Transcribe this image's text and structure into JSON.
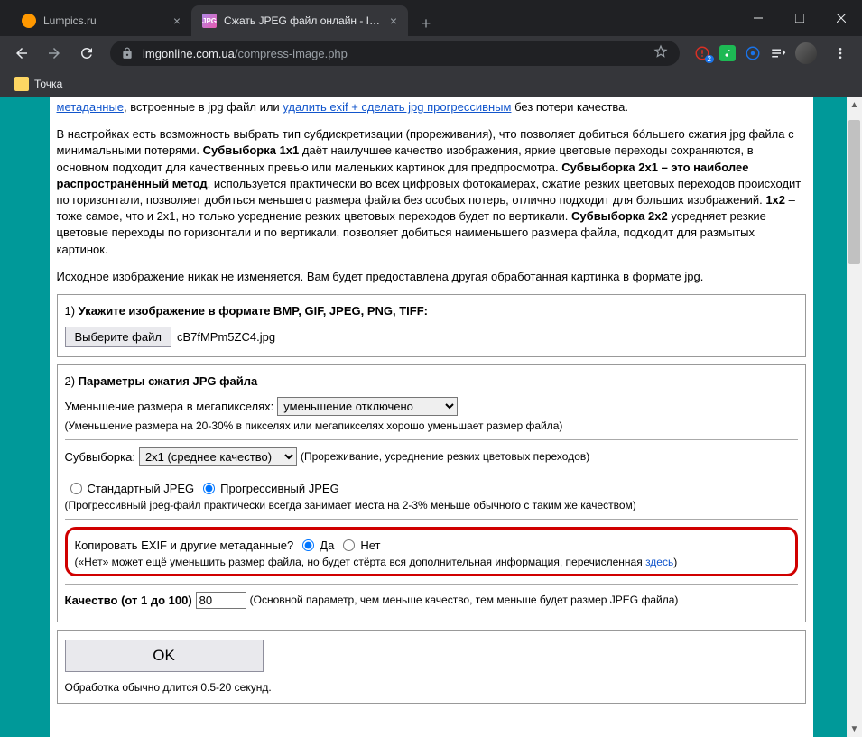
{
  "tabs": [
    {
      "title": "Lumpics.ru"
    },
    {
      "title": "Сжать JPEG файл онлайн - IMG"
    }
  ],
  "url": {
    "domain": "imgonline.com.ua",
    "path": "/compress-image.php"
  },
  "bookmarks": {
    "folder": "Точка"
  },
  "content": {
    "p1_link1": "метаданные",
    "p1_mid": ", встроенные в jpg файл или ",
    "p1_link2": "удалить exif + сделать jpg прогрессивным",
    "p1_end": " без потери качества.",
    "p2_a": "В настройках есть возможность выбрать тип субдискретизации (прореживания), что позволяет добиться бóльшего сжатия jpg файла с минимальными потерями. ",
    "p2_b1": "Субвыборка 1x1",
    "p2_c": " даёт наилучшее качество изображения, яркие цветовые переходы сохраняются, в основном подходит для качественных превью или маленьких картинок для предпросмотра. ",
    "p2_b2": "Субвыборка 2x1 – это наиболее распространённый метод",
    "p2_d": ", используется практически во всех цифровых фотокамерах, сжатие резких цветовых переходов происходит по горизонтали, позволяет добиться меньшего размера файла без особых потерь, отлично подходит для больших изображений. ",
    "p2_b3": "1x2",
    "p2_e": " – тоже самое, что и 2x1, но только усреднение резких цветовых переходов будет по вертикали. ",
    "p2_b4": "Субвыборка 2x2",
    "p2_f": " усредняет резкие цветовые переходы по горизонтали и по вертикали, позволяет добиться наименьшего размера файла, подходит для размытых картинок.",
    "p3": "Исходное изображение никак не изменяется. Вам будет предоставлена другая обработанная картинка в формате jpg."
  },
  "step1": {
    "title_num": "1) ",
    "title": "Укажите изображение в формате BMP, GIF, JPEG, PNG, TIFF:",
    "file_btn": "Выберите файл",
    "filename": "cB7fMPm5ZC4.jpg"
  },
  "step2": {
    "title_num": "2) ",
    "title": "Параметры сжатия JPG файла",
    "resize_label": "Уменьшение размера в мегапикселях:",
    "resize_value": "уменьшение отключено",
    "resize_hint": "(Уменьшение размера на 20-30% в пикселях или мегапикселях хорошо уменьшает размер файла)",
    "subsample_label": "Субвыборка:",
    "subsample_value": "2x1 (среднее качество)",
    "subsample_hint": "(Прореживание, усреднение резких цветовых переходов)",
    "jpeg_std": "Стандартный JPEG",
    "jpeg_prog": "Прогрессивный JPEG",
    "jpeg_hint": "(Прогрессивный jpeg-файл практически всегда занимает места на 2-3% меньше обычного с таким же качеством)",
    "exif_label": "Копировать EXIF и другие метаданные?",
    "exif_yes": "Да",
    "exif_no": "Нет",
    "exif_hint_a": "(«Нет» может ещё уменьшить размер файла, но будет стёрта вся дополнительная информация, перечисленная ",
    "exif_hint_link": "здесь",
    "exif_hint_b": ")",
    "quality_label": "Качество (от 1 до 100)",
    "quality_value": "80",
    "quality_hint": "(Основной параметр, чем меньше качество, тем меньше будет размер JPEG файла)"
  },
  "step3": {
    "ok_btn": "OK",
    "processing_hint": "Обработка обычно длится 0.5-20 секунд."
  }
}
